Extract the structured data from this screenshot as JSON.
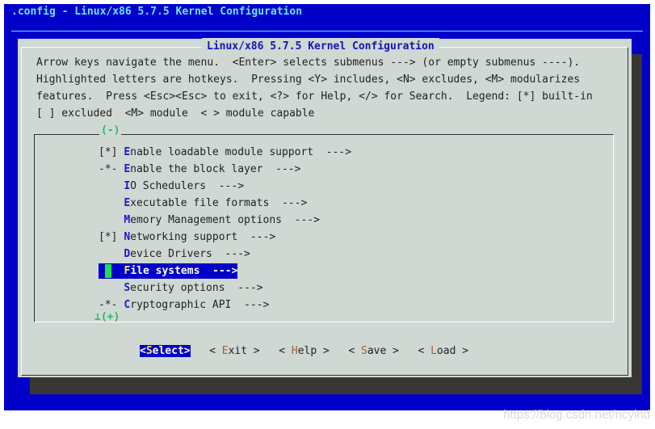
{
  "window_title": ".config - Linux/x86 5.7.5 Kernel Configuration",
  "dialog_title": "Linux/x86 5.7.5 Kernel Configuration",
  "help_lines": [
    "Arrow keys navigate the menu.  <Enter> selects submenus ---> (or empty submenus ----).",
    "Highlighted letters are hotkeys.  Pressing <Y> includes, <N> excludes, <M> modularizes",
    "features.  Press <Esc><Esc> to exit, <?> for Help, </> for Search.  Legend: [*] built-in",
    "[ ] excluded  <M> module  < > module capable"
  ],
  "scroll_up": "(-)",
  "scroll_down": "⊥(+)",
  "menu": [
    {
      "prefix": "[*] ",
      "hot": "E",
      "rest": "nable loadable module support  --->"
    },
    {
      "prefix": "-*- ",
      "hot": "E",
      "rest": "nable the block layer  --->"
    },
    {
      "prefix": "    ",
      "hot": "I",
      "rest": "O Schedulers  --->"
    },
    {
      "prefix": "    ",
      "hot": "E",
      "rest": "xecutable file formats  --->"
    },
    {
      "prefix": "    ",
      "hot": "M",
      "rest": "emory Management options  --->"
    },
    {
      "prefix": "[*] ",
      "hot": "N",
      "rest": "etworking support  --->"
    },
    {
      "prefix": "    ",
      "hot": "D",
      "rest": "evice Drivers  --->"
    },
    {
      "prefix": "    ",
      "hot": "F",
      "rest": "ile systems  --->",
      "selected": true
    },
    {
      "prefix": "    ",
      "hot": "S",
      "rest": "ecurity options  --->"
    },
    {
      "prefix": "-*- ",
      "hot": "C",
      "rest": "ryptographic API  --->"
    }
  ],
  "buttons": [
    {
      "l": "<",
      "hot": "S",
      "rest": "elect",
      "r": ">",
      "selected": true
    },
    {
      "l": "< ",
      "hot": "E",
      "rest": "xit",
      "r": " >"
    },
    {
      "l": "< ",
      "hot": "H",
      "rest": "elp",
      "r": " >"
    },
    {
      "l": "< ",
      "hot": "S",
      "rest": "ave",
      "r": " >"
    },
    {
      "l": "< ",
      "hot": "L",
      "rest": "oad",
      "r": " >"
    }
  ],
  "watermark": "https://blog.csdn.net/ncyind",
  "colors": {
    "background": "#0000c8",
    "dialog": "#cfd8d3",
    "hotkey": "#1a1acb",
    "cursor": "#1ee04a"
  }
}
